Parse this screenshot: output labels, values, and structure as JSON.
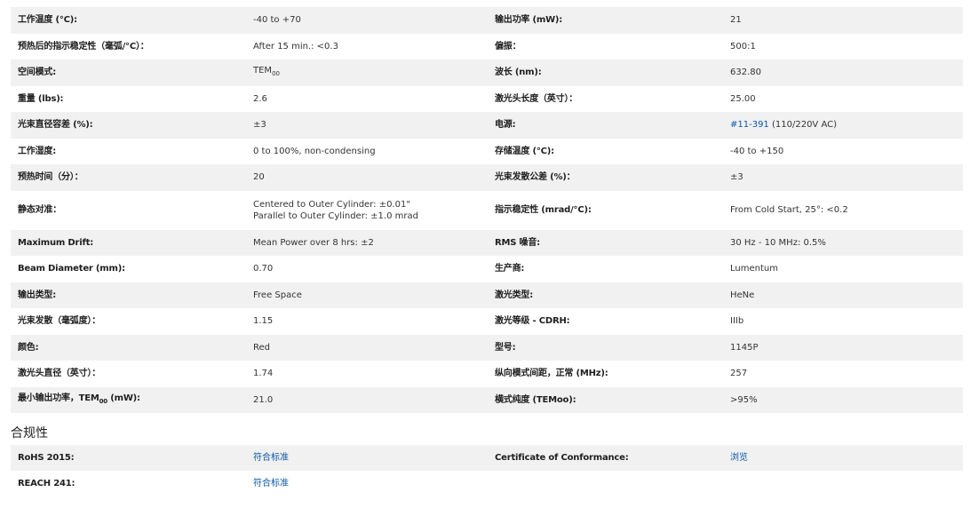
{
  "specs": {
    "rows": [
      {
        "l1": "工作温度 (°C):",
        "v1": "-40 to +70",
        "l2": "输出功率 (mW):",
        "v2": "21"
      },
      {
        "l1": "预热后的指示稳定性（毫弧/°C）：",
        "v1": "After 15 min.: <0.3",
        "l2": "偏振：",
        "v2": "500:1"
      },
      {
        "l1": "空间模式:",
        "v1": "TEM",
        "v1sub": "00",
        "l2": "波长 (nm):",
        "v2": "632.80"
      },
      {
        "l1": "重量 (lbs):",
        "v1": "2.6",
        "l2": "激光头长度（英寸）：",
        "v2": "25.00"
      },
      {
        "l1": "光束直径容差 (%):",
        "v1": "±3",
        "l2": "电源:",
        "v2_link": "#11-391",
        "v2": " (110/220V AC)"
      },
      {
        "l1": "工作湿度:",
        "v1": "0 to 100%, non-condensing",
        "l2": "存储温度 (°C):",
        "v2": "-40 to +150"
      },
      {
        "l1": "预热时间（分）：",
        "v1": "20",
        "l2": "光束发散公差 (%)：",
        "v2": "±3"
      },
      {
        "l1": "静态对准：",
        "v1": "Centered to Outer Cylinder: ±0.01\"",
        "v1b": "Parallel to Outer Cylinder: ±1.0 mrad",
        "l2": "指示稳定性 (mrad/°C):",
        "v2": "From Cold Start, 25°: <0.2"
      },
      {
        "l1": "Maximum Drift:",
        "v1": "Mean Power over 8 hrs: ±2",
        "l2": "RMS 噪音:",
        "v2": "30 Hz - 10 MHz: 0.5%"
      },
      {
        "l1": "Beam Diameter (mm):",
        "v1": "0.70",
        "l2": "生产商:",
        "v2": "Lumentum"
      },
      {
        "l1": "输出类型:",
        "v1": "Free Space",
        "l2": "激光类型:",
        "v2": "HeNe"
      },
      {
        "l1": "光束发散（毫弧度）：",
        "v1": "1.15",
        "l2": "激光等级 - CDRH:",
        "v2": "IIIb"
      },
      {
        "l1": "颜色:",
        "v1": "Red",
        "l2": "型号:",
        "v2": "1145P"
      },
      {
        "l1": "激光头直径（英寸）：",
        "v1": "1.74",
        "l2": "纵向模式间距，正常 (MHz):",
        "v2": "257"
      },
      {
        "l1": "最小输出功率，TEM",
        "l1sub": "00",
        "l1tail": " (mW):",
        "v1": "21.0",
        "l2": "横式纯度 (TEMoo):",
        "v2": ">95%"
      }
    ]
  },
  "compliance": {
    "title": "合规性",
    "rows": [
      {
        "l1": "RoHS 2015:",
        "v1_link": "符合标准",
        "l2": "Certificate of Conformance:",
        "v2_link": "浏览"
      },
      {
        "l1": "REACH 241:",
        "v1_link": "符合标准",
        "l2": "",
        "v2_link": ""
      }
    ]
  },
  "colors": {
    "link": "#0b58a6",
    "row_shade": "#f1f1f1"
  }
}
